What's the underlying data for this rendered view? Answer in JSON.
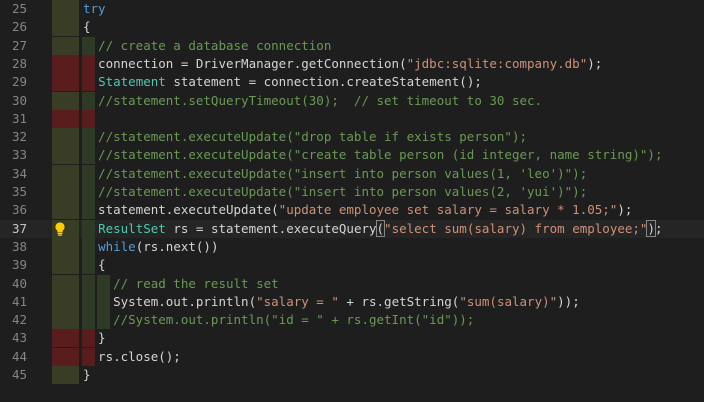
{
  "editor": {
    "lines": [
      {
        "n": "25",
        "tokens": [
          {
            "t": "try",
            "c": "kw"
          }
        ]
      },
      {
        "n": "26",
        "tokens": [
          {
            "t": "{",
            "c": "plain"
          }
        ]
      },
      {
        "n": "27",
        "tokens": [
          {
            "t": "  // create a database connection",
            "c": "com"
          }
        ]
      },
      {
        "n": "28",
        "tokens": [
          {
            "t": "  connection = DriverManager.getConnection(",
            "c": "plain"
          },
          {
            "t": "\"jdbc:sqlite:company.db\"",
            "c": "str"
          },
          {
            "t": ");",
            "c": "plain"
          }
        ]
      },
      {
        "n": "29",
        "tokens": [
          {
            "t": "  ",
            "c": "plain"
          },
          {
            "t": "Statement",
            "c": "type"
          },
          {
            "t": " statement = connection.createStatement();",
            "c": "plain"
          }
        ]
      },
      {
        "n": "30",
        "tokens": [
          {
            "t": "  //statement.setQueryTimeout(30);  // set timeout to 30 sec.",
            "c": "com"
          }
        ]
      },
      {
        "n": "31",
        "tokens": []
      },
      {
        "n": "32",
        "tokens": [
          {
            "t": "  //statement.executeUpdate(\"drop table if exists person\");",
            "c": "com"
          }
        ]
      },
      {
        "n": "33",
        "tokens": [
          {
            "t": "  //statement.executeUpdate(\"create table person (id integer, name string)\");",
            "c": "com"
          }
        ]
      },
      {
        "n": "34",
        "tokens": [
          {
            "t": "  //statement.executeUpdate(\"insert into person values(1, 'leo')\");",
            "c": "com"
          }
        ]
      },
      {
        "n": "35",
        "tokens": [
          {
            "t": "  //statement.executeUpdate(\"insert into person values(2, 'yui')\");",
            "c": "com"
          }
        ]
      },
      {
        "n": "36",
        "tokens": [
          {
            "t": "  statement.executeUpdate(",
            "c": "plain"
          },
          {
            "t": "\"update employee set salary = salary * 1.05;\"",
            "c": "str"
          },
          {
            "t": ");",
            "c": "plain"
          }
        ]
      },
      {
        "n": "37",
        "tokens": [
          {
            "t": "  ",
            "c": "plain"
          },
          {
            "t": "ResultSet",
            "c": "type"
          },
          {
            "t": " rs = statement.executeQuery",
            "c": "plain"
          },
          {
            "t": "(",
            "c": "plain",
            "hl": true
          },
          {
            "t": "\"select sum(salary) from employee;\"",
            "c": "str"
          },
          {
            "t": ")",
            "c": "plain",
            "hl": true
          },
          {
            "t": ";",
            "c": "plain"
          }
        ]
      },
      {
        "n": "38",
        "tokens": [
          {
            "t": "  ",
            "c": "plain"
          },
          {
            "t": "while",
            "c": "kw"
          },
          {
            "t": "(rs.next())",
            "c": "plain"
          }
        ]
      },
      {
        "n": "39",
        "tokens": [
          {
            "t": "  {",
            "c": "plain"
          }
        ]
      },
      {
        "n": "40",
        "tokens": [
          {
            "t": "    // read the result set",
            "c": "com"
          }
        ]
      },
      {
        "n": "41",
        "tokens": [
          {
            "t": "    System.out.println(",
            "c": "plain"
          },
          {
            "t": "\"salary = \"",
            "c": "str"
          },
          {
            "t": " + rs.getString(",
            "c": "plain"
          },
          {
            "t": "\"sum(salary)\"",
            "c": "str"
          },
          {
            "t": "));",
            "c": "plain"
          }
        ]
      },
      {
        "n": "42",
        "tokens": [
          {
            "t": "    //System.out.println(\"id = \" + rs.getInt(\"id\"));",
            "c": "com"
          }
        ]
      },
      {
        "n": "43",
        "tokens": [
          {
            "t": "  }",
            "c": "plain"
          }
        ]
      },
      {
        "n": "44",
        "tokens": [
          {
            "t": "  rs.close();",
            "c": "plain"
          }
        ]
      },
      {
        "n": "45",
        "tokens": [
          {
            "t": "}",
            "c": "plain"
          }
        ]
      }
    ],
    "active_line": "37",
    "red_fold_lines": [
      "28",
      "29",
      "31",
      "43",
      "44"
    ],
    "red_guide_lines": [
      "28",
      "29",
      "31",
      "43",
      "44"
    ],
    "colors": {
      "background": "#1e1e1e",
      "keyword": "#569cd6",
      "type": "#4ec9b0",
      "string": "#ce9178",
      "comment": "#6a9955",
      "text": "#d4d4d4",
      "line_number": "#858585",
      "gutter_diff": "#5a1d1d"
    },
    "lightbulb_icon": "lightbulb-icon"
  }
}
